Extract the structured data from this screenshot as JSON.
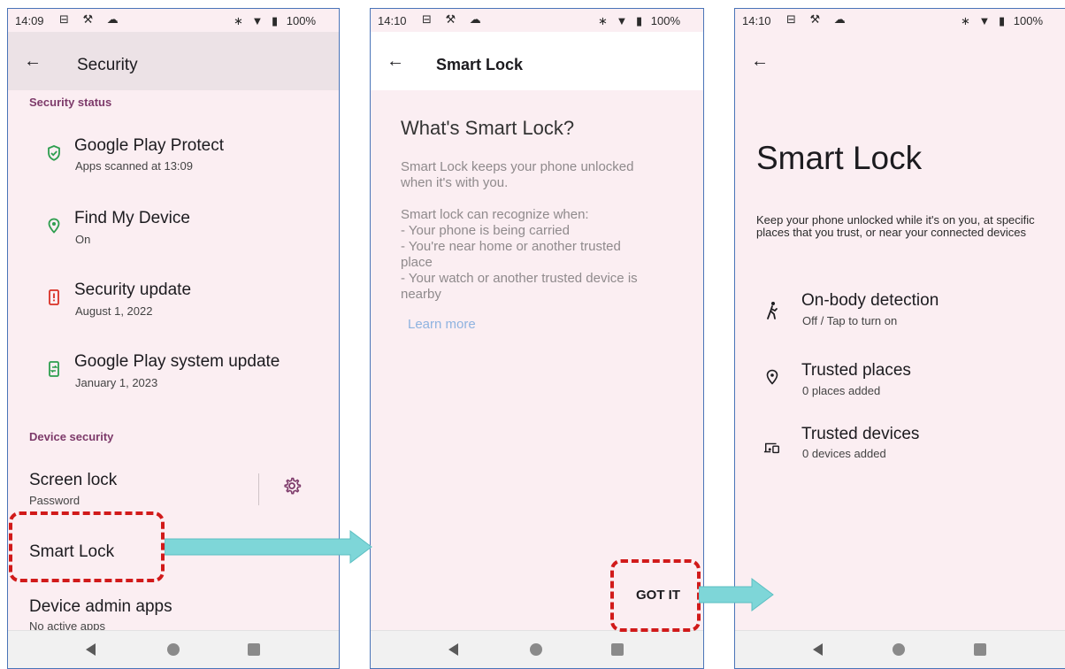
{
  "panel1": {
    "status_time": "14:09",
    "status_battery": "100%",
    "title": "Security",
    "section_status": "Security status",
    "items": [
      {
        "title": "Google Play Protect",
        "subtitle": "Apps scanned at 13:09"
      },
      {
        "title": "Find My Device",
        "subtitle": "On"
      },
      {
        "title": "Security update",
        "subtitle": "August 1, 2022"
      },
      {
        "title": "Google Play system update",
        "subtitle": "January 1, 2023"
      }
    ],
    "section_device": "Device security",
    "screen_lock": {
      "title": "Screen lock",
      "subtitle": "Password"
    },
    "smart_lock": "Smart Lock",
    "device_admin": {
      "title": "Device admin apps",
      "subtitle": "No active apps"
    }
  },
  "panel2": {
    "status_time": "14:10",
    "status_battery": "100%",
    "title": "Smart Lock",
    "heading": "What's Smart Lock?",
    "body": "Smart Lock keeps your phone unlocked\nwhen it's with you.\n\nSmart lock can recognize when:\n - Your phone is being carried\n - You're near home or another trusted\nplace\n - Your watch or another trusted device is\nnearby",
    "learn_more": "Learn more",
    "got_it": "GOT IT"
  },
  "panel3": {
    "status_time": "14:10",
    "status_battery": "100%",
    "title": "Smart Lock",
    "description": "Keep your phone unlocked while it's on you, at specific places that you trust, or near your connected devices",
    "items": [
      {
        "title": "On-body detection",
        "subtitle": "Off / Tap to turn on"
      },
      {
        "title": "Trusted places",
        "subtitle": "0 places added"
      },
      {
        "title": "Trusted devices",
        "subtitle": "0 devices added"
      }
    ]
  },
  "icons": {
    "shield": "shield-check-icon",
    "location": "location-pin-icon",
    "update": "security-update-icon",
    "system_update": "system-update-icon",
    "gear": "gear-icon",
    "walk": "walking-person-icon",
    "devices": "devices-icon"
  },
  "colors": {
    "accent": "#7d3a6a",
    "green": "#2e9e4f",
    "red": "#d93025",
    "annotation_red": "#d11a1a",
    "arrow_teal": "#7ed6d8",
    "link": "#8fb3e0"
  }
}
